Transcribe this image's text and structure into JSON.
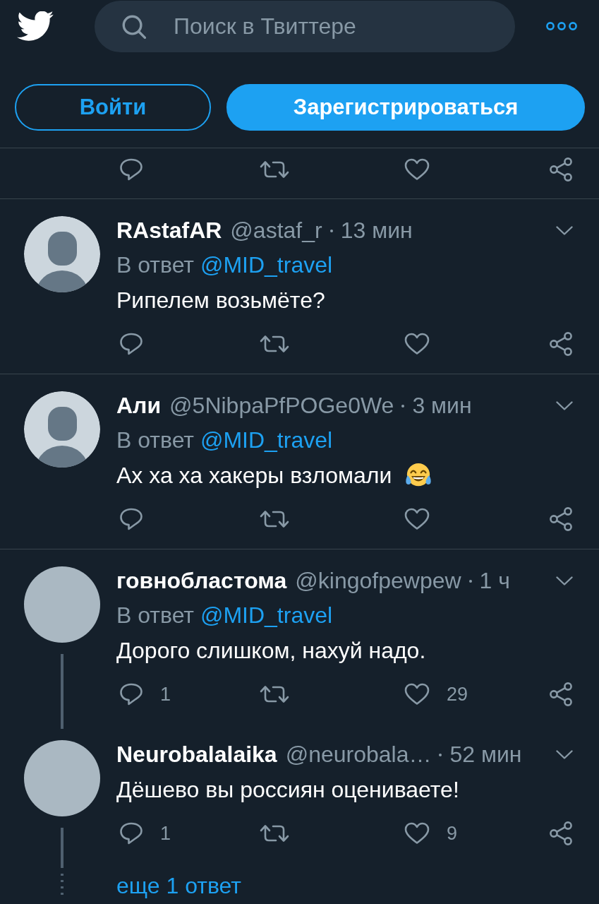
{
  "header": {
    "search": {
      "placeholder": "Поиск в Твиттере"
    }
  },
  "auth_buttons": [
    {
      "label": "Войти",
      "kind": "outline"
    },
    {
      "label": "Зарегистрироваться",
      "kind": "filled"
    }
  ],
  "partial_tweet": {
    "actions": [
      {
        "kind": "reply"
      },
      {
        "kind": "retweet"
      },
      {
        "kind": "like"
      },
      {
        "kind": "share"
      }
    ]
  },
  "tweets": [
    {
      "avatar": {
        "kind": "silhouette"
      },
      "name": "RAstafAR",
      "handle": "@astaf_r",
      "time": "13 мин",
      "reply_to": {
        "prefix": "В ответ",
        "handle": "@MID_travel"
      },
      "text": "Рипелем возьмёте?",
      "trailing_emoji": false,
      "thread_line": false,
      "actions": [
        {
          "kind": "reply"
        },
        {
          "kind": "retweet"
        },
        {
          "kind": "like"
        },
        {
          "kind": "share"
        }
      ]
    },
    {
      "avatar": {
        "kind": "silhouette"
      },
      "name": "Али",
      "handle": "@5NibpaPfPOGe0We",
      "time": "3 мин",
      "reply_to": {
        "prefix": "В ответ",
        "handle": "@MID_travel"
      },
      "text": "Ах ха ха хакеры взломали",
      "trailing_emoji": true,
      "thread_line": false,
      "actions": [
        {
          "kind": "reply"
        },
        {
          "kind": "retweet"
        },
        {
          "kind": "like"
        },
        {
          "kind": "share"
        }
      ]
    },
    {
      "avatar": {
        "kind": "plain"
      },
      "name": "говнобластома",
      "handle": "@kingofpewpew",
      "time": "1 ч",
      "reply_to": {
        "prefix": "В ответ",
        "handle": "@MID_travel"
      },
      "text": "Дорого слишком, нахуй надо.",
      "trailing_emoji": false,
      "thread_line": true,
      "actions": [
        {
          "kind": "reply",
          "count": "1"
        },
        {
          "kind": "retweet"
        },
        {
          "kind": "like",
          "count": "29"
        },
        {
          "kind": "share"
        }
      ]
    },
    {
      "avatar": {
        "kind": "plain"
      },
      "name": "Neurobalalaika",
      "handle": "@neurobala…",
      "time": "52 мин",
      "text": "Дёшево вы россиян оцениваете!",
      "trailing_emoji": false,
      "thread_line": true,
      "actions": [
        {
          "kind": "reply",
          "count": "1"
        },
        {
          "kind": "retweet"
        },
        {
          "kind": "like",
          "count": "9"
        },
        {
          "kind": "share"
        }
      ]
    }
  ],
  "more_replies": {
    "label": "еще 1 ответ"
  }
}
